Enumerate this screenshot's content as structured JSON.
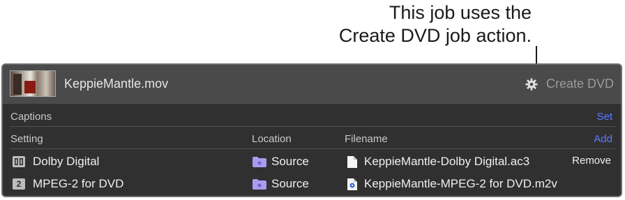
{
  "callout": {
    "line1": "This job uses the",
    "line2": "Create DVD job action."
  },
  "job": {
    "file_name": "KeppieMantle.mov",
    "action_label": "Create DVD"
  },
  "captions": {
    "label": "Captions",
    "link": "Set"
  },
  "table": {
    "headers": {
      "setting": "Setting",
      "location": "Location",
      "filename": "Filename",
      "add": "Add"
    },
    "rows": [
      {
        "icon": "dolby-icon",
        "icon_text": "",
        "setting": "Dolby Digital",
        "location": "Source",
        "filename": "KeppieMantle-Dolby Digital.ac3",
        "file_icon": "document-icon",
        "action": "Remove"
      },
      {
        "icon": "mpeg2-icon",
        "icon_text": "2",
        "setting": "MPEG-2 for DVD",
        "location": "Source",
        "filename": "KeppieMantle-MPEG-2 for DVD.m2v",
        "file_icon": "video-file-icon",
        "action": ""
      }
    ]
  },
  "colors": {
    "link": "#5b7bff",
    "folder": "#a89cf0"
  }
}
